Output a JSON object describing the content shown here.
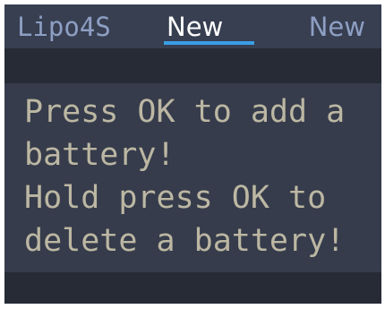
{
  "tabs": {
    "previous": "Lipo4S",
    "current": "New",
    "next": "New"
  },
  "message": {
    "line1": "Press OK to add a",
    "line2": "battery!",
    "line3": "Hold press OK to",
    "line4": "delete a battery!"
  },
  "colors": {
    "background": "#262b36",
    "tab_bar": "#373f51",
    "content_panel": "#363c4b",
    "tab_inactive_text": "#8e9fc4",
    "tab_active_text": "#ffffff",
    "tab_indicator": "#3a9ee6",
    "message_text": "#bcb7a3"
  }
}
